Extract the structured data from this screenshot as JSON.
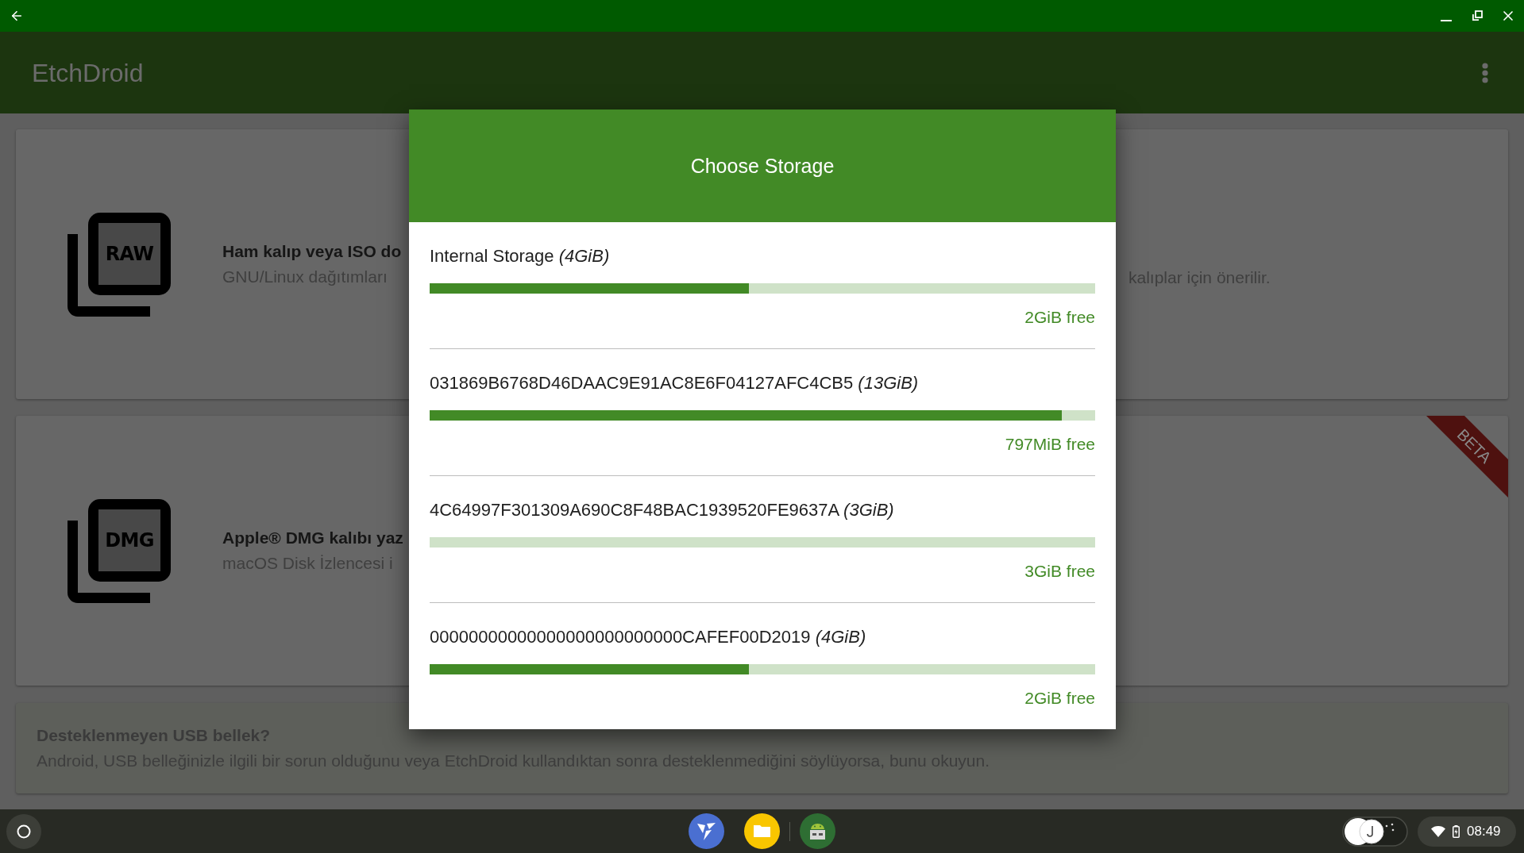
{
  "app_bar": {
    "title": "EtchDroid"
  },
  "cards": [
    {
      "icon_text": "RAW",
      "title": "Ham kalıp veya ISO do",
      "subtitle": "GNU/Linux dağıtımları",
      "subtitle_right": "kalıplar için önerilir."
    },
    {
      "icon_text": "DMG",
      "title": "Apple® DMG kalıbı yaz",
      "subtitle": "macOS Disk İzlencesi i",
      "ribbon": "BETA"
    }
  ],
  "notice": {
    "title": "Desteklenmeyen USB bellek?",
    "text": "Android, USB belleğinizle ilgili bir sorun olduğunu veya EtchDroid kullandıktan sonra desteklenmediğini söylüyorsa, bunu okuyun."
  },
  "dialog": {
    "title": "Choose Storage",
    "storages": [
      {
        "name": "Internal Storage *(4GiB)*",
        "level": 0.48,
        "free": "2GiB free"
      },
      {
        "name": "031869B6768D46DAAC9E91AC8E6F04127AFC4CB5 *(13GiB)*",
        "level": 0.95,
        "free": "797MiB free"
      },
      {
        "name": "4C64997F301309A690C8F48BAC1939520FE9637A *(3GiB)*",
        "level": 0,
        "free": "3GiB free"
      },
      {
        "name": "00000000000000000000000000CAFEF00D2019 *(4GiB)*",
        "level": 0.48,
        "free": "2GiB free"
      }
    ]
  },
  "status_area": {
    "time": "08:49"
  }
}
